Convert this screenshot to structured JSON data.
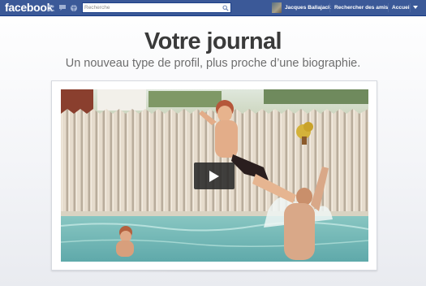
{
  "topbar": {
    "logo": "facebook",
    "search": {
      "placeholder": "Recherche",
      "value": ""
    },
    "user_name": "Jacques Ballajack",
    "find_friends": "Rechercher des amis",
    "home": "Accueil",
    "icons": [
      "friend-requests-icon",
      "messages-icon",
      "notifications-icon",
      "search-icon",
      "chevron-down-icon"
    ],
    "colors": {
      "bar": "#3b5998",
      "bar_border": "#133783"
    }
  },
  "hero": {
    "title": "Votre journal",
    "subtitle": "Un nouveau type de profil, plus proche d’une biographie."
  },
  "video": {
    "icon": "play-icon"
  }
}
